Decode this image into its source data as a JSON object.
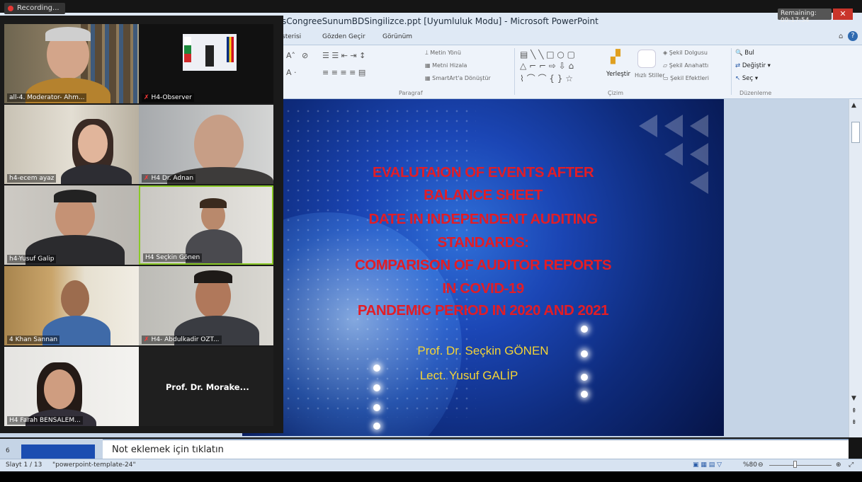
{
  "powerpoint": {
    "title": "sCongreeSunumBDSingilizce.ppt [Uyumluluk Modu] - Microsoft PowerPoint",
    "tabs": [
      "sterisi",
      "Gözden Geçir",
      "Görünüm"
    ],
    "ribbon": {
      "metin_yonu": "Metin Yönü",
      "metni_hizala": "Metni Hizala",
      "smartart": "SmartArt'a Dönüştür",
      "paragraf": "Paragraf",
      "yerlestir": "Yerleştir",
      "hizli_stiller": "Hızlı Stiller",
      "sekil_dolgusu": "Şekil Dolgusu",
      "sekil_anahatti": "Şekil Anahattı",
      "sekil_efektleri": "Şekil Efektleri",
      "cizim": "Çizim",
      "bul": "Bul",
      "degistir": "Değiştir",
      "sec": "Seç",
      "duzenleme": "Düzenleme"
    },
    "slide": {
      "title_lines": [
        "EVALUTAION OF EVENTS AFTER",
        "BALANCE SHEET",
        "DATE IN INDEPENDENT AUDITING",
        "STANDARDS:",
        "COMPARISON OF AUDITOR REPORTS",
        "IN COVID-19",
        "PANDEMIC PERIOD IN 2020 AND 2021"
      ],
      "authors": [
        "Prof. Dr. Seçkin GÖNEN",
        "Lect. Yusuf GALİP"
      ],
      "colors": {
        "title": "#e21d26",
        "authors": "#f3d436"
      }
    },
    "notes_placeholder": "Not eklemek için tıklatın",
    "status": {
      "slide": "Slayt 1 / 13",
      "template": "\"powerpoint-template-24\"",
      "zoom": "%80"
    },
    "thumb_index": "6"
  },
  "meeting": {
    "recording_label": "Recording...",
    "remaining_label": "Remaining: 09:17:54",
    "participants": [
      {
        "name": "all-4. Moderator- Ahm...",
        "muted": false
      },
      {
        "name": "H4-Observer",
        "muted": true
      },
      {
        "name": "h4-ecem ayaz",
        "muted": false
      },
      {
        "name": "H4 Dr. Adnan",
        "muted": true
      },
      {
        "name": "h4-Yusuf Galip",
        "muted": false
      },
      {
        "name": "H4 Seçkin Gönen",
        "muted": false
      },
      {
        "name": "4 Khan Sannan",
        "muted": false
      },
      {
        "name": "H4- Abdulkadir OZT...",
        "muted": true
      },
      {
        "name": "H4 Farah BENSALEM...",
        "muted": false
      },
      {
        "name": "Prof. Dr. Morake...",
        "muted": false
      }
    ]
  }
}
